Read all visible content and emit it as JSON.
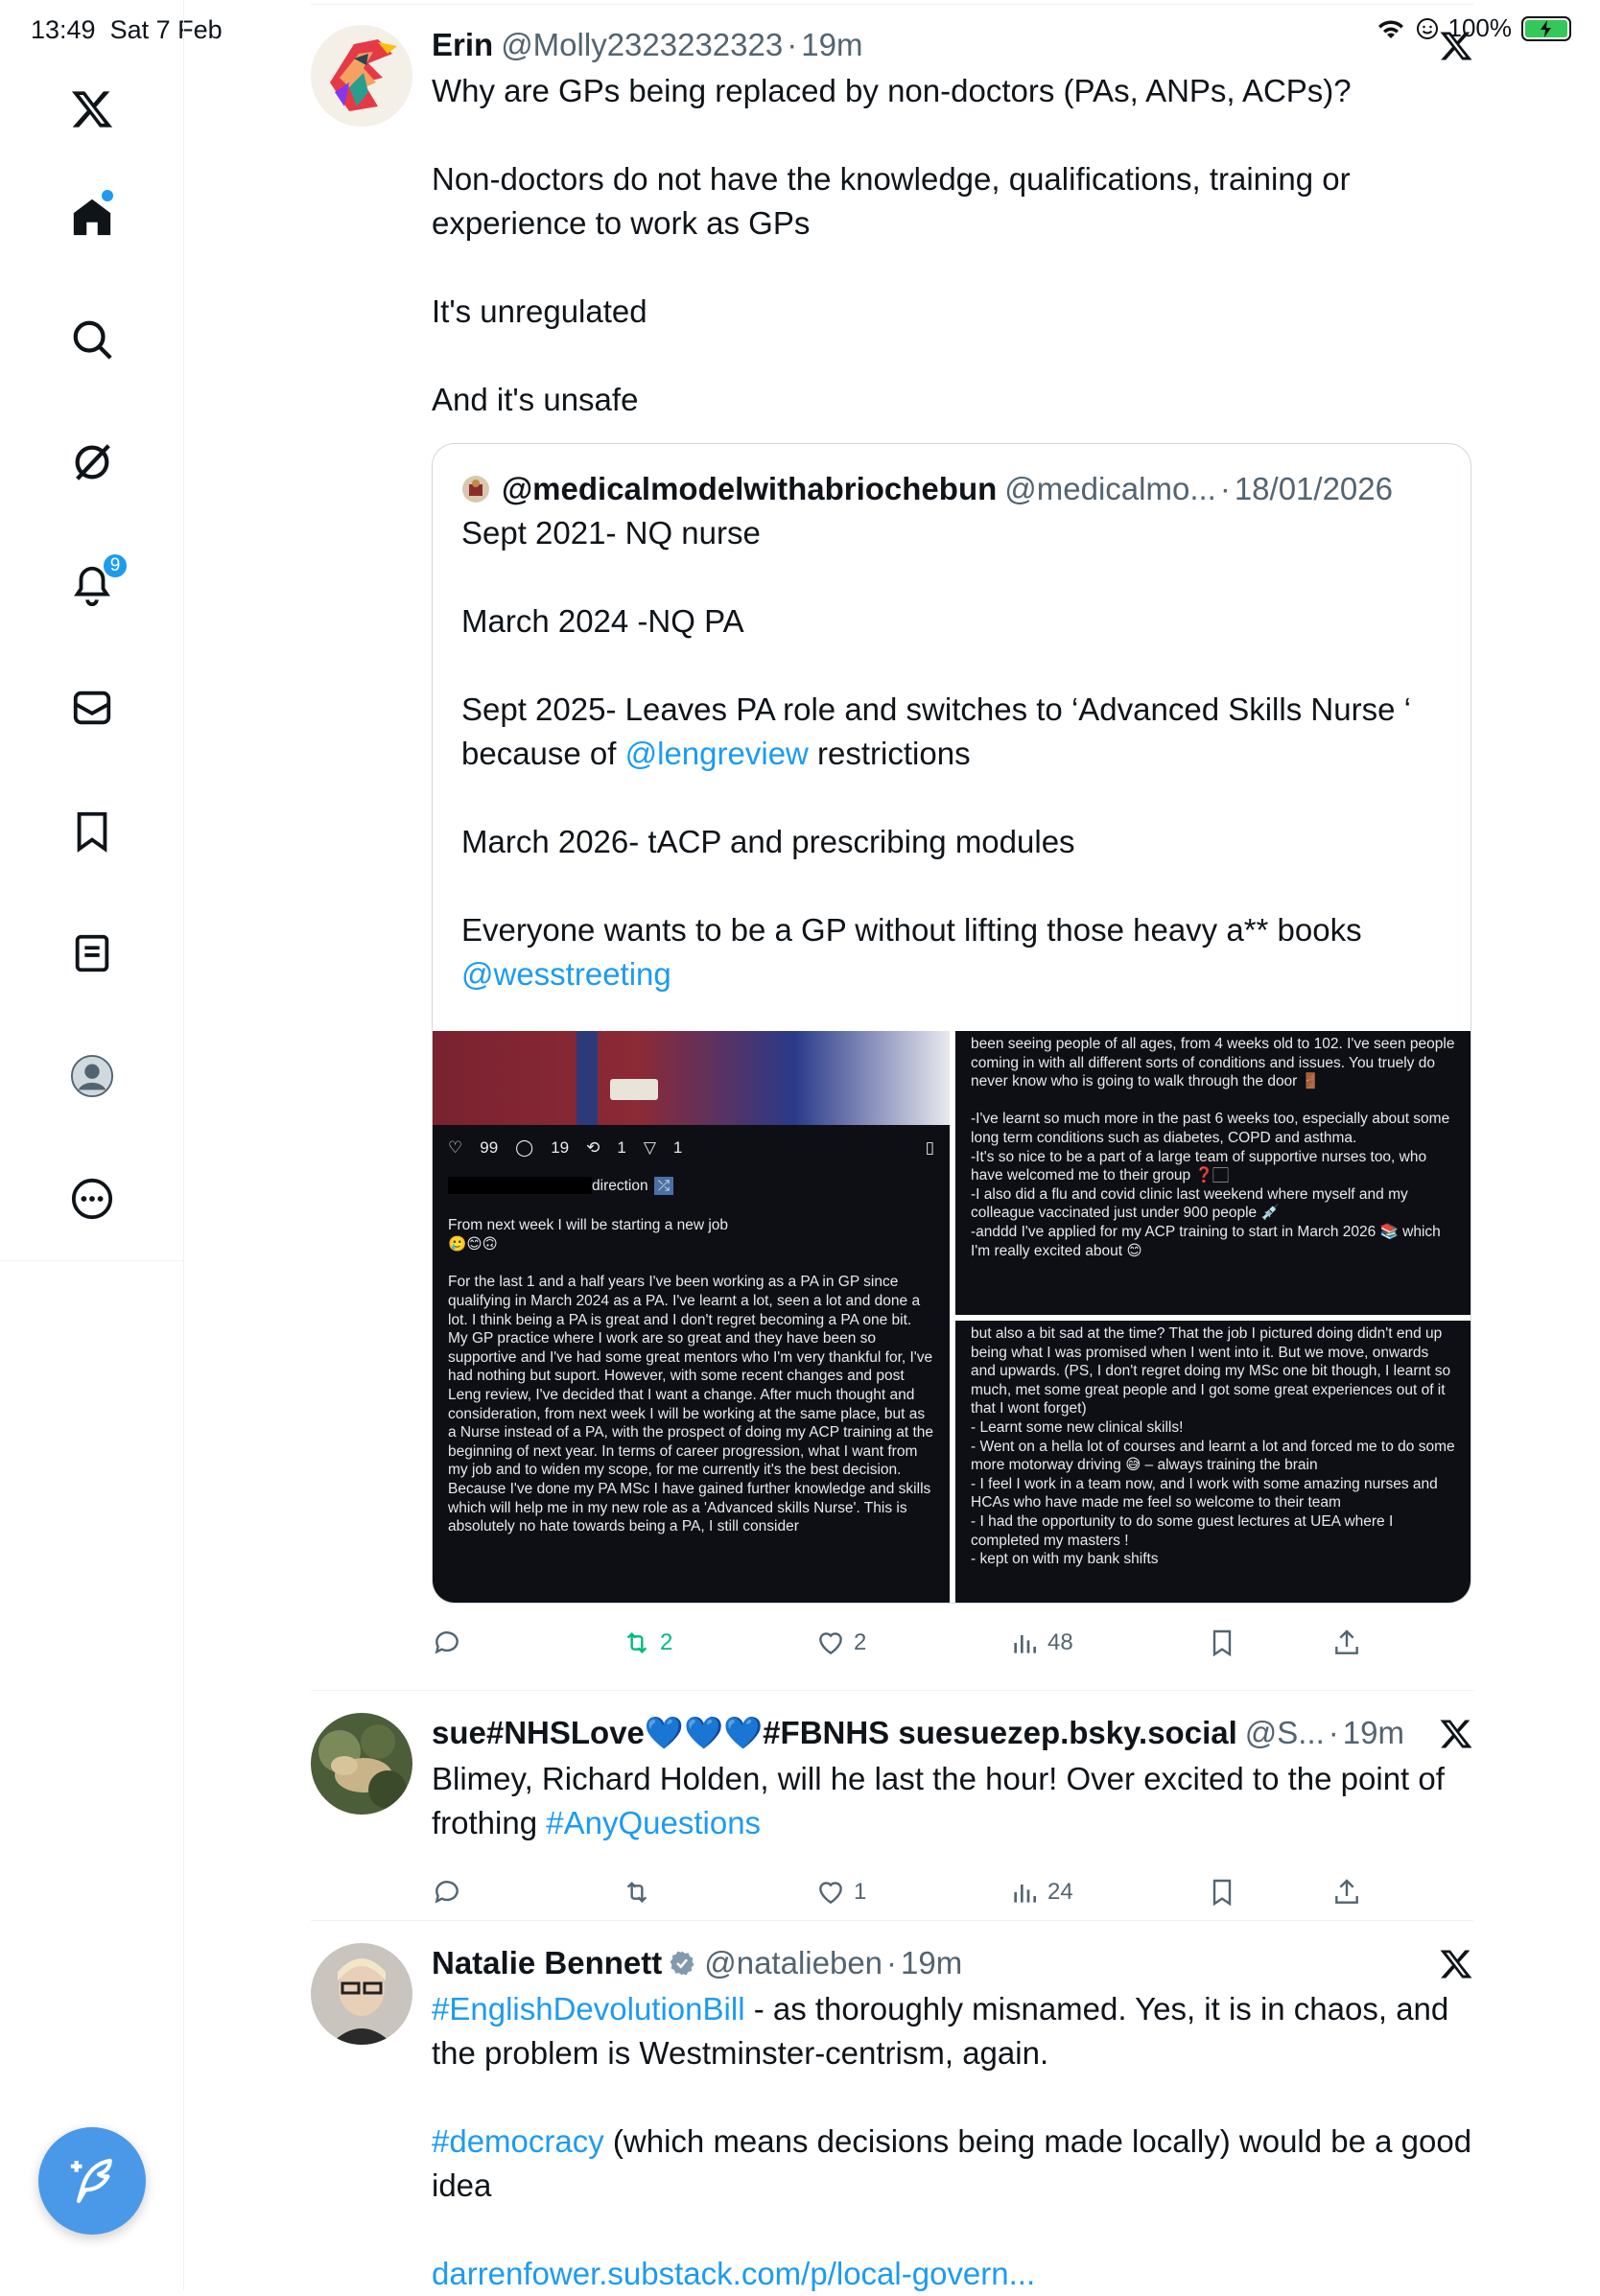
{
  "status_bar": {
    "time": "13:49",
    "date": "Sat 7 Feb",
    "battery": "100%"
  },
  "sidebar": {
    "items": [
      {
        "icon": "x-logo-icon"
      },
      {
        "icon": "home-icon"
      },
      {
        "icon": "search-icon"
      },
      {
        "icon": "grok-icon"
      },
      {
        "icon": "notifications-icon",
        "badge": "9"
      },
      {
        "icon": "messages-icon"
      },
      {
        "icon": "bookmarks-icon"
      },
      {
        "icon": "lists-icon"
      },
      {
        "icon": "profile-icon"
      },
      {
        "icon": "more-icon"
      }
    ],
    "compose_icon": "compose-icon"
  },
  "tweets": [
    {
      "name": "Erin",
      "handle": "@Molly2323232323",
      "sep": "·",
      "ago": "19m",
      "text": [
        "Why are GPs being replaced by non-doctors (PAs, ANPs, ACPs)?",
        "Non-doctors do not have the knowledge, qualifications, training or experience to work as GPs",
        "It's unregulated",
        "And it's unsafe"
      ],
      "quote": {
        "name": "@medicalmodelwithabriochebun",
        "handle": "@medicalmo...",
        "sep": "·",
        "date": "18/01/2026",
        "p1": "Sept 2021- NQ nurse",
        "p2": "March 2024 -NQ PA",
        "p3a": "Sept 2025- Leaves PA role and switches to ‘Advanced Skills Nurse ‘ because of ",
        "p3link": "@lengreview",
        "p3b": " restrictions",
        "p4": "March 2026-  tACP and prescribing modules",
        "p5": "Everyone wants to be a GP without lifting those heavy a** books",
        "p5link": "@wesstreeting",
        "images": {
          "panel1": {
            "likes": "99",
            "comments": "19",
            "reposts": "1",
            "shares": "1",
            "label": "direction",
            "line1": "From next week I will be starting a new job",
            "emoji1": "🥲😊🙃",
            "para": "For the last 1 and a half years I've been working as a PA in GP since qualifying in March 2024 as a PA. I've learnt a lot, seen a lot and done a lot. I think being a PA is great and I don't regret becoming a PA one bit. My GP practice where I work are so great and they have been so supportive and I've had some great mentors who I'm very thankful for, I've had nothing but suport. However, with some recent changes and post Leng review, I've decided that I want a change. After much thought and consideration, from next week I will be working at the same place, but as a Nurse instead of a PA, with the prospect of doing my ACP training at the beginning of next year. In terms of career progression, what I want from my job and to widen my scope, for me currently it's the best decision. Because I've done my PA MSc I have gained further knowledge and skills which will help me in my new role as a 'Advanced skills Nurse'. This is absolutely no hate towards being a PA, I still consider"
          },
          "panel2": "been seeing people of all ages, from 4 weeks old to 102. I've seen people coming in with all different sorts of conditions and issues. You truely do never know who is going to walk through the door 🚪\n\n-I've learnt so much more in the past 6 weeks too, especially about some long term conditions such as diabetes, COPD and asthma.\n-It's so nice to be a part of a large team of supportive nurses too, who have welcomed me to their group ❓🏻\n-I also did a flu and covid clinic last weekend where myself and my colleague vaccinated just under 900 people 💉\n-anddd I've applied for my ACP training to start in March 2026 📚 which I'm really excited about 😊",
          "panel3": "but also a bit sad at the time? That the job I pictured doing didn't end up being what I was promised when I went into it. But we move, onwards and upwards. (PS, I don't regret doing my MSc one bit though, I learnt so much, met some great people and I got some great experiences out of it that I wont forget)\n- Learnt some new clinical skills!\n- Went on a hella lot of courses and learnt a lot and forced me to do some more motorway driving 😅 – always training the brain\n- I feel I work in a team now, and I work with some amazing nurses and HCAs who have made me feel so welcome to their team\n- I had the opportunity to do some guest lectures at UEA where I completed my masters !\n- kept on with my bank shifts"
        }
      },
      "actions": {
        "replies": "",
        "reposts": "2",
        "likes": "2",
        "views": "48"
      }
    },
    {
      "name": "sue#NHSLove💙💙💙#FBNHS suesuezep.bsky.social",
      "handle": "@S...",
      "sep": "·",
      "ago": "19m",
      "text_a": "Blimey, Richard Holden, will he last the hour! Over excited to the point of frothing ",
      "text_link": "#AnyQuestions",
      "actions": {
        "replies": "",
        "reposts": "",
        "likes": "1",
        "views": "24"
      }
    },
    {
      "name": "Natalie Bennett",
      "handle": "@natalieben",
      "sep": "·",
      "ago": "19m",
      "p1_link": "#EnglishDevolutionBill",
      "p1_text": " - as thoroughly misnamed. Yes, it is in chaos, and the problem is Westminster-centrism, again.",
      "p2_link": "#democracy",
      "p2_text": " (which means decisions being made locally) would be a good idea",
      "p3_link": "darrenfower.substack.com/p/local-govern..."
    }
  ],
  "colors": {
    "accent": "#1d9bf0",
    "repost_active": "#00ba7c",
    "text": "#0f1419",
    "muted": "#536471"
  }
}
